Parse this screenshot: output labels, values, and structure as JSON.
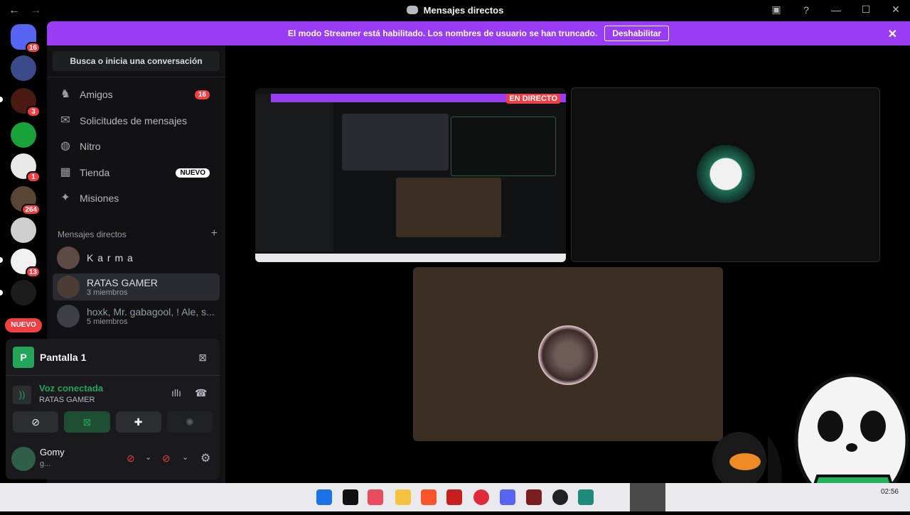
{
  "window": {
    "title": "Mensajes directos",
    "back_icon": "←",
    "forward_icon": "→",
    "controls": [
      "—",
      "☐",
      "✕"
    ]
  },
  "banner": {
    "text": "El modo Streamer está habilitado. Los nombres de usuario se han truncado.",
    "button": "Deshabilitar",
    "close": "✕"
  },
  "guilds": {
    "badges": [
      "16",
      "3",
      "1",
      "264",
      "13"
    ],
    "new_label": "NUEVO"
  },
  "sidebar": {
    "search": "Busca o inicia una conversación",
    "nav": [
      {
        "label": "Amigos",
        "icon": "friends-icon",
        "badge": "16"
      },
      {
        "label": "Solicitudes de mensajes",
        "icon": "mail-icon"
      },
      {
        "label": "Nitro",
        "icon": "nitro-icon"
      },
      {
        "label": "Tienda",
        "icon": "shop-icon",
        "tag": "NUEVO"
      },
      {
        "label": "Misiones",
        "icon": "quests-icon"
      }
    ],
    "dm_header": "Mensajes directos",
    "dm_plus": "+",
    "dms": [
      {
        "name": "K a r m a",
        "sub": ""
      },
      {
        "name": "RATAS GAMER",
        "sub": "3 miembros"
      },
      {
        "name": "hoxk, Mr. gabagool, ! Ale, s...",
        "sub": "5 miembros"
      }
    ]
  },
  "panel": {
    "screen_letter": "P",
    "screen_title": "Pantalla 1",
    "voice_status": "Voz conectada",
    "voice_channel": "RATAS GAMER",
    "user_name": "Gomy",
    "user_sub": "g..."
  },
  "stage": {
    "live_label": "EN DIRECTO"
  },
  "taskbar": {
    "clock": "02:56"
  },
  "colors": {
    "accent_purple": "#9b3cf5",
    "green": "#23a559",
    "red": "#f23f43"
  }
}
